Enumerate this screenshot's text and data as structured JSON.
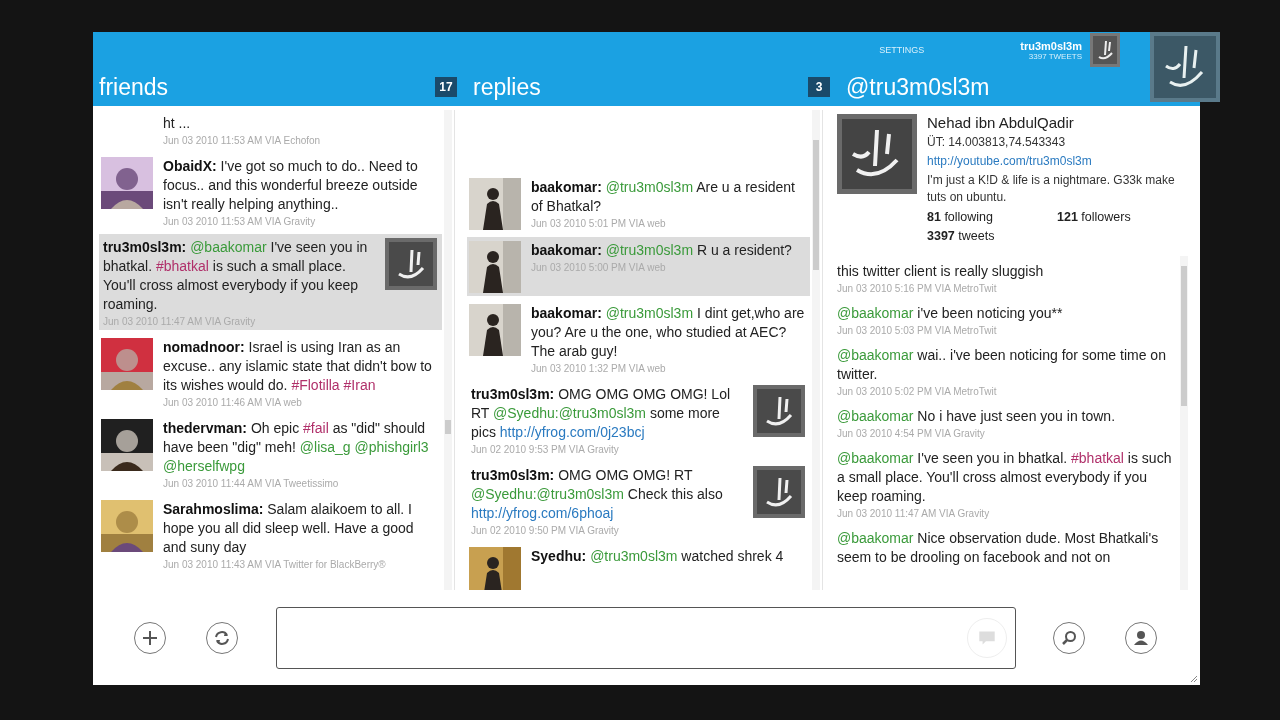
{
  "header": {
    "settings": "SETTINGS",
    "user": "tru3m0sl3m",
    "tweets": "3397 TWEETS"
  },
  "columns": [
    {
      "title": "friends",
      "count": "17"
    },
    {
      "title": "replies",
      "count": "3"
    },
    {
      "title": "@tru3m0sl3m"
    }
  ],
  "friends": [
    {
      "avatar": false,
      "own": false,
      "selected": false,
      "segments": [
        {
          "kind": "text",
          "text": "ht ..."
        }
      ],
      "meta": "Jun 03 2010 11:53 AM VIA Echofon"
    },
    {
      "avatar": true,
      "own": false,
      "selected": false,
      "user": "ObaidX:",
      "segments": [
        {
          "kind": "text",
          "text": "I've got so much to do.. Need to focus.. and this wonderful breeze outside isn't really helping anything.."
        }
      ],
      "meta": "Jun 03 2010 11:53 AM VIA Gravity"
    },
    {
      "avatar": true,
      "own": true,
      "selected": true,
      "user": "tru3m0sl3m:",
      "segments": [
        {
          "kind": "mention",
          "text": "@baakomar"
        },
        {
          "kind": "text",
          "text": "I've seen you in bhatkal."
        },
        {
          "kind": "hashtag",
          "text": "#bhatkal"
        },
        {
          "kind": "text",
          "text": "is such a small place. You'll cross almost everybody if you keep roaming."
        }
      ],
      "meta": "Jun 03 2010 11:47 AM VIA Gravity"
    },
    {
      "avatar": true,
      "own": false,
      "selected": false,
      "user": "nomadnoor:",
      "segments": [
        {
          "kind": "text",
          "text": "Israel is using Iran as an excuse.. any islamic state that didn't bow to its wishes would do."
        },
        {
          "kind": "hashtag",
          "text": "#Flotilla"
        },
        {
          "kind": "hashtag",
          "text": "#Iran"
        }
      ],
      "meta": "Jun 03 2010 11:46 AM VIA web"
    },
    {
      "avatar": true,
      "own": false,
      "selected": false,
      "user": "thedervman:",
      "segments": [
        {
          "kind": "text",
          "text": "Oh epic"
        },
        {
          "kind": "hashtag",
          "text": "#fail"
        },
        {
          "kind": "text",
          "text": "as \"did\" should have been \"dig\" meh!"
        },
        {
          "kind": "mention",
          "text": "@lisa_g"
        },
        {
          "kind": "mention",
          "text": "@phishgirl3"
        },
        {
          "kind": "mention",
          "text": "@herselfwpg"
        }
      ],
      "meta": "Jun 03 2010 11:44 AM VIA Tweetissimo"
    },
    {
      "avatar": true,
      "own": false,
      "selected": false,
      "user": "Sarahmoslima:",
      "segments": [
        {
          "kind": "text",
          "text": "Salam alaikoem to all. I hope you all did sleep well. Have a good and suny day"
        }
      ],
      "meta": "Jun 03 2010 11:43 AM VIA Twitter for BlackBerry®"
    }
  ],
  "replies": [
    {
      "avatar": true,
      "own": false,
      "selected": false,
      "user": "baakomar:",
      "segments": [
        {
          "kind": "mention",
          "text": "@tru3m0sl3m"
        },
        {
          "kind": "text",
          "text": "Are u a resident of Bhatkal?"
        }
      ],
      "meta": "Jun 03 2010 5:01 PM VIA web"
    },
    {
      "avatar": true,
      "own": false,
      "selected": true,
      "user": "baakomar:",
      "segments": [
        {
          "kind": "mention",
          "text": "@tru3m0sl3m"
        },
        {
          "kind": "text",
          "text": "R u a resident?"
        }
      ],
      "meta": "Jun 03 2010 5:00 PM VIA web"
    },
    {
      "avatar": true,
      "own": false,
      "selected": false,
      "user": "baakomar:",
      "segments": [
        {
          "kind": "mention",
          "text": "@tru3m0sl3m"
        },
        {
          "kind": "text",
          "text": "I dint get,who are you? Are u the one, who studied at AEC? The arab guy!"
        }
      ],
      "meta": "Jun 03 2010 1:32 PM VIA web"
    },
    {
      "avatar": true,
      "own": true,
      "selected": false,
      "user": "tru3m0sl3m:",
      "segments": [
        {
          "kind": "text",
          "text": "OMG OMG OMG OMG! Lol RT"
        },
        {
          "kind": "mention",
          "text": "@Syedhu:@tru3m0sl3m"
        },
        {
          "kind": "text",
          "text": "some more pics"
        },
        {
          "kind": "link",
          "text": "http://yfrog.com/0j23bcj"
        }
      ],
      "meta": "Jun 02 2010 9:53 PM VIA Gravity"
    },
    {
      "avatar": true,
      "own": true,
      "selected": false,
      "user": "tru3m0sl3m:",
      "segments": [
        {
          "kind": "text",
          "text": "OMG OMG OMG! RT"
        },
        {
          "kind": "mention",
          "text": "@Syedhu:@tru3m0sl3m"
        },
        {
          "kind": "text",
          "text": "Check this also"
        },
        {
          "kind": "link",
          "text": "http://yfrog.com/6phoaj"
        }
      ],
      "meta": "Jun 02 2010 9:50 PM VIA Gravity"
    },
    {
      "avatar": true,
      "own": false,
      "selected": false,
      "user": "Syedhu:",
      "segments": [
        {
          "kind": "mention",
          "text": "@tru3m0sl3m"
        },
        {
          "kind": "text",
          "text": "watched shrek 4"
        }
      ]
    }
  ],
  "profile": {
    "name": "Nehad ibn AbdulQadir",
    "location": "ÜT: 14.003813,74.543343",
    "url": "http://youtube.com/tru3m0sl3m",
    "bio": "I'm just a K!D & life is a nightmare. G33k make tuts on ubuntu.",
    "stats": [
      "**81** following",
      "**121** followers",
      "**3397** tweets"
    ]
  },
  "profile_tweets": [
    {
      "segments": [
        {
          "kind": "text",
          "text": "this twitter client is really sluggish"
        }
      ],
      "meta": "Jun 03 2010 5:16 PM VIA MetroTwit"
    },
    {
      "segments": [
        {
          "kind": "mention",
          "text": "@baakomar"
        },
        {
          "kind": "text",
          "text": "i've been noticing you**"
        }
      ],
      "meta": "Jun 03 2010 5:03 PM VIA MetroTwit"
    },
    {
      "segments": [
        {
          "kind": "mention",
          "text": "@baakomar"
        },
        {
          "kind": "text",
          "text": "wai.. i've been noticing for some time on twitter."
        }
      ],
      "meta": "Jun 03 2010 5:02 PM VIA MetroTwit"
    },
    {
      "segments": [
        {
          "kind": "mention",
          "text": "@baakomar"
        },
        {
          "kind": "text",
          "text": "No i have just seen you in town."
        }
      ],
      "meta": "Jun 03 2010 4:54 PM VIA Gravity"
    },
    {
      "segments": [
        {
          "kind": "mention",
          "text": "@baakomar"
        },
        {
          "kind": "text",
          "text": "I've seen you in bhatkal."
        },
        {
          "kind": "hashtag",
          "text": "#bhatkal"
        },
        {
          "kind": "text",
          "text": "is such a small place. You'll cross almost everybody if you keep roaming."
        }
      ],
      "meta": "Jun 03 2010 11:47 AM VIA Gravity"
    },
    {
      "segments": [
        {
          "kind": "mention",
          "text": "@baakomar"
        },
        {
          "kind": "text",
          "text": "Nice observation dude. Most Bhatkali's seem to be drooling on facebook and not on"
        }
      ]
    }
  ]
}
